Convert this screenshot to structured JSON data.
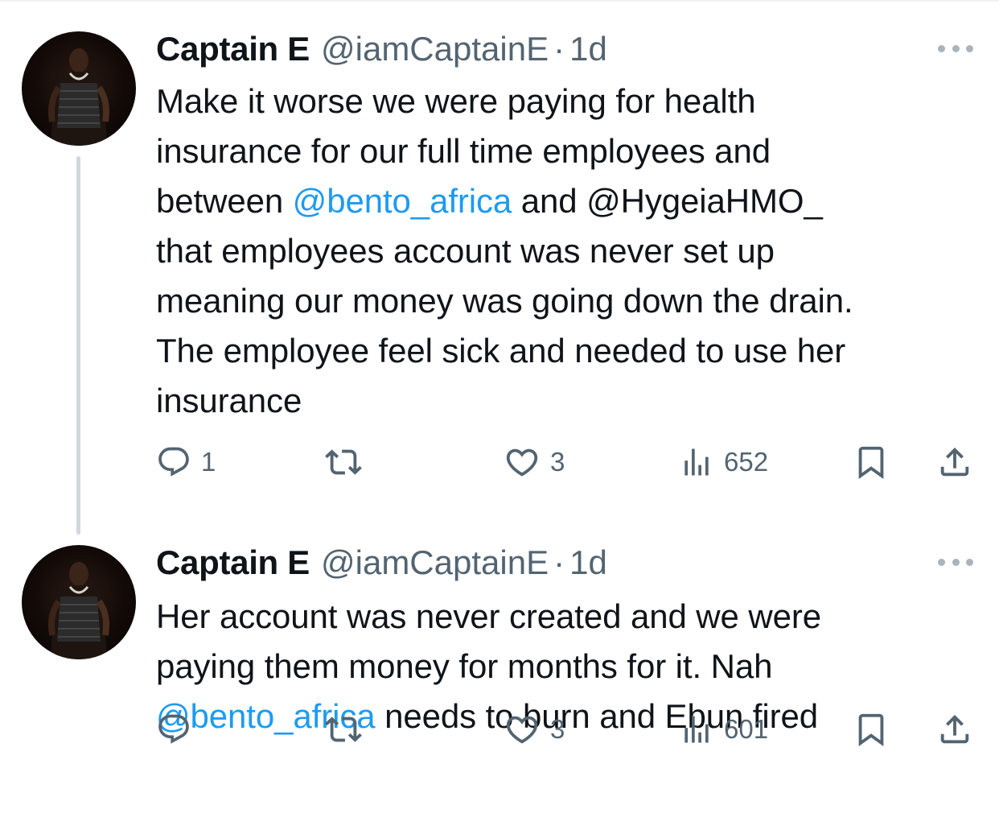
{
  "tweets": [
    {
      "display_name": "Captain E",
      "handle": "@iamCaptainE",
      "separator": "·",
      "time": "1d",
      "text_lines": [
        [
          {
            "t": "Make it worse we were paying for health"
          }
        ],
        [
          {
            "t": "insurance for our full time employees and"
          }
        ],
        [
          {
            "t": "between "
          },
          {
            "t": "@bento_africa",
            "mention": true
          },
          {
            "t": " and @HygeiaHMO_"
          }
        ],
        [
          {
            "t": "that employees account was never set up"
          }
        ],
        [
          {
            "t": "meaning our money was going down the drain."
          }
        ],
        [
          {
            "t": "The employee feel sick and needed to use her"
          }
        ],
        [
          {
            "t": "insurance"
          }
        ]
      ],
      "replies": "1",
      "retweets": "",
      "likes": "3",
      "views": "652"
    },
    {
      "display_name": "Captain E",
      "handle": "@iamCaptainE",
      "separator": "·",
      "time": "1d",
      "text_lines": [
        [
          {
            "t": "Her account was never created and we were"
          }
        ],
        [
          {
            "t": "paying them money for months for it. Nah"
          }
        ],
        [
          {
            "t": "@bento_africa",
            "mention": true
          },
          {
            "t": " needs to burn and Ebun fired"
          }
        ]
      ],
      "replies": "",
      "retweets": "",
      "likes": "3",
      "views": "601"
    }
  ],
  "icons": {
    "reply": "reply-icon",
    "retweet": "retweet-icon",
    "like": "heart-icon",
    "views": "views-icon",
    "bookmark": "bookmark-icon",
    "share": "share-icon",
    "more": "more-icon"
  },
  "colors": {
    "text": "#0f1419",
    "secondary": "#536471",
    "mention": "#1d9bf0",
    "thread_line": "#cfd9de"
  }
}
